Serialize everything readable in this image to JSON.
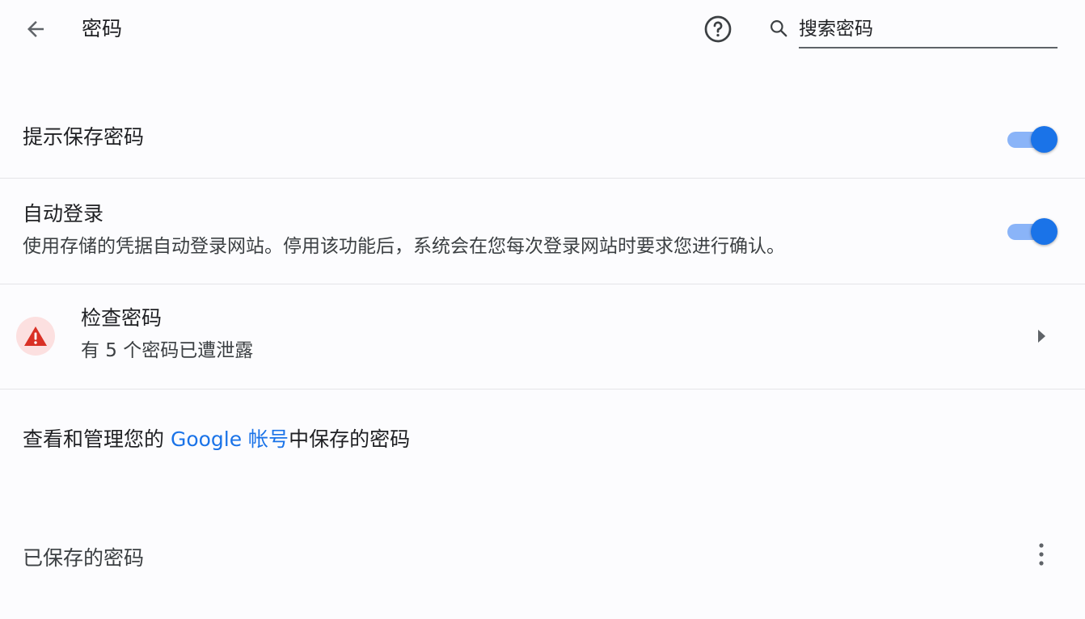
{
  "header": {
    "title": "密码",
    "back_icon": "arrow-left-icon",
    "help_icon": "help-circle-icon",
    "search_icon": "search-icon",
    "search_placeholder": "搜索密码",
    "search_value": ""
  },
  "settings": {
    "offer_to_save": {
      "label": "提示保存密码",
      "enabled": true
    },
    "auto_sign_in": {
      "label": "自动登录",
      "description": "使用存储的凭据自动登录网站。停用该功能后，系统会在您每次登录网站时要求您进行确认。",
      "enabled": true
    },
    "check_passwords": {
      "label": "检查密码",
      "status": "有 5 个密码已遭泄露",
      "icon": "warning-icon"
    }
  },
  "manage": {
    "prefix": "查看和管理您的 ",
    "link": "Google 帐号",
    "suffix": "中保存的密码"
  },
  "saved": {
    "heading": "已保存的密码",
    "more_icon": "more-vert-icon"
  },
  "colors": {
    "accent": "#1a73e8",
    "toggle_track": "#8ab4f8",
    "warning": "#d93025",
    "warning_bg": "#fce0e0",
    "background": "#fcfcfe",
    "divider": "#e4e4e8"
  }
}
